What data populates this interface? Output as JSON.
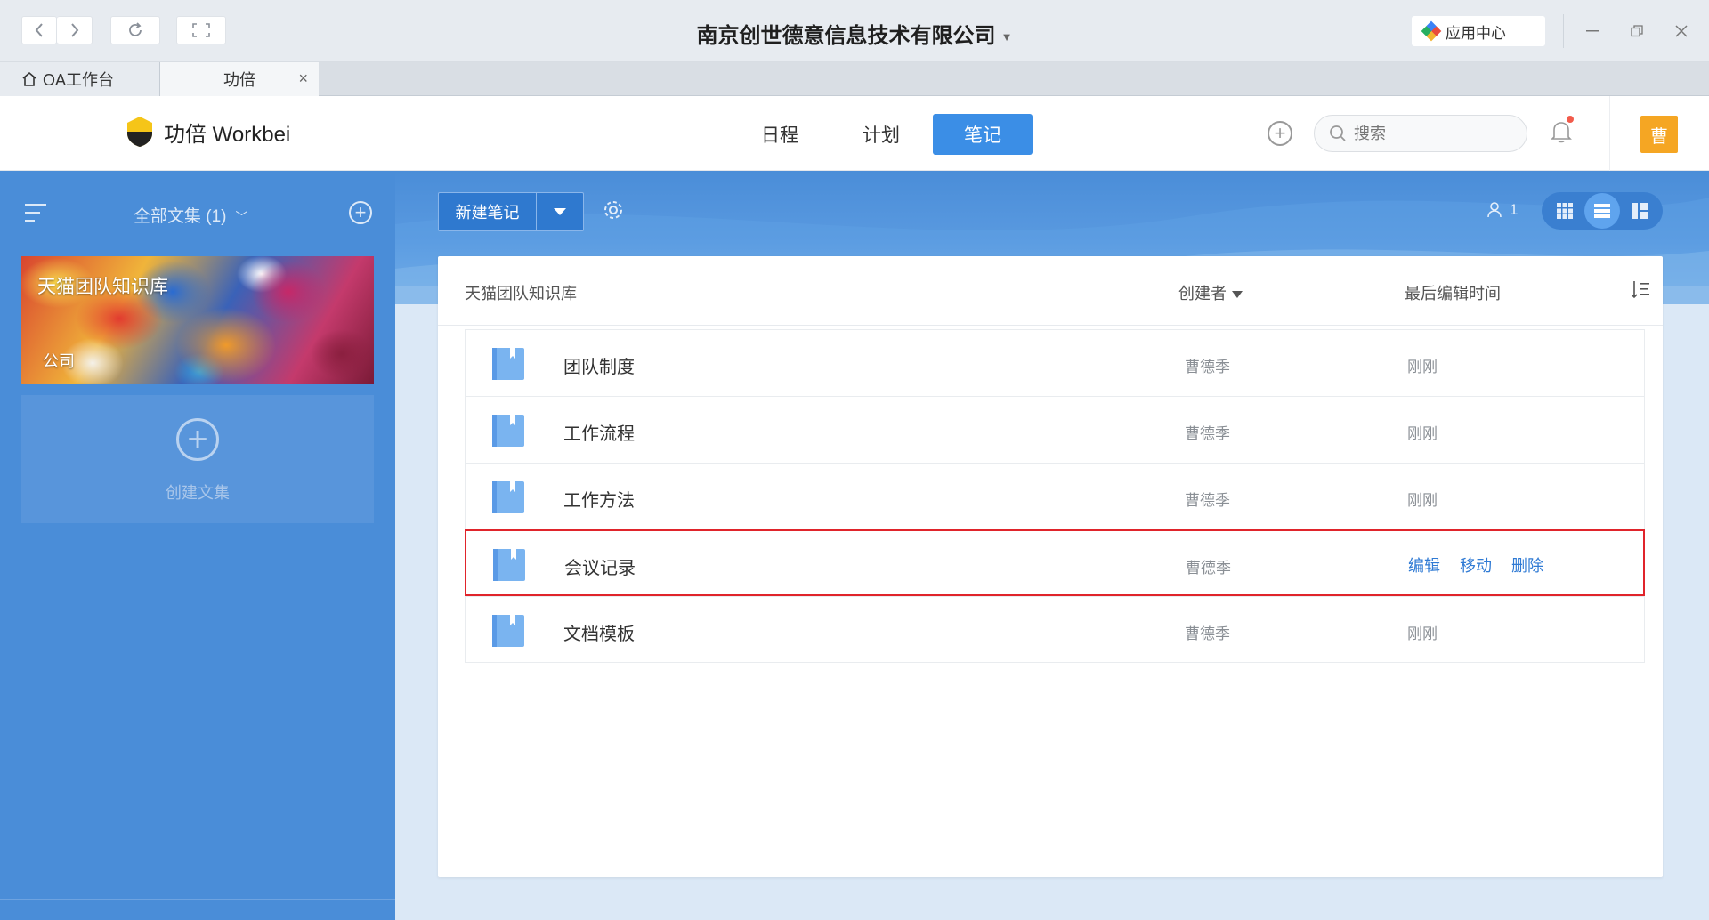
{
  "window": {
    "title": "南京创世德意信息技术有限公司",
    "app_center_label": "应用中心"
  },
  "tabs": [
    {
      "label": "OA工作台",
      "icon": "home-icon"
    },
    {
      "label": "功倍",
      "close": "×"
    }
  ],
  "header": {
    "logo_text": "功倍 Workbei",
    "nav": [
      {
        "label": "日程",
        "active": false
      },
      {
        "label": "计划",
        "active": false
      },
      {
        "label": "笔记",
        "active": true
      }
    ],
    "search_placeholder": "搜索",
    "avatar_text": "曹",
    "accent": "#3b8ee6",
    "avatar_color": "#f5a623"
  },
  "sidebar": {
    "title": "全部文集 (1)",
    "books": [
      {
        "name": "天猫团队知识库",
        "tag": "公司"
      }
    ],
    "create_label": "创建文集"
  },
  "toolbar": {
    "new_note_label": "新建笔记",
    "member_count": "1"
  },
  "list": {
    "header": {
      "name": "天猫团队知识库",
      "creator": "创建者",
      "time": "最后编辑时间"
    },
    "rows": [
      {
        "title": "团队制度",
        "creator": "曹德季",
        "time": "刚刚"
      },
      {
        "title": "工作流程",
        "creator": "曹德季",
        "time": "刚刚"
      },
      {
        "title": "工作方法",
        "creator": "曹德季",
        "time": "刚刚"
      },
      {
        "title": "会议记录",
        "creator": "曹德季",
        "time": "",
        "actions": [
          "编辑",
          "移动",
          "删除"
        ]
      },
      {
        "title": "文档模板",
        "creator": "曹德季",
        "time": "刚刚"
      }
    ]
  },
  "highlight_color": "#e0242b"
}
